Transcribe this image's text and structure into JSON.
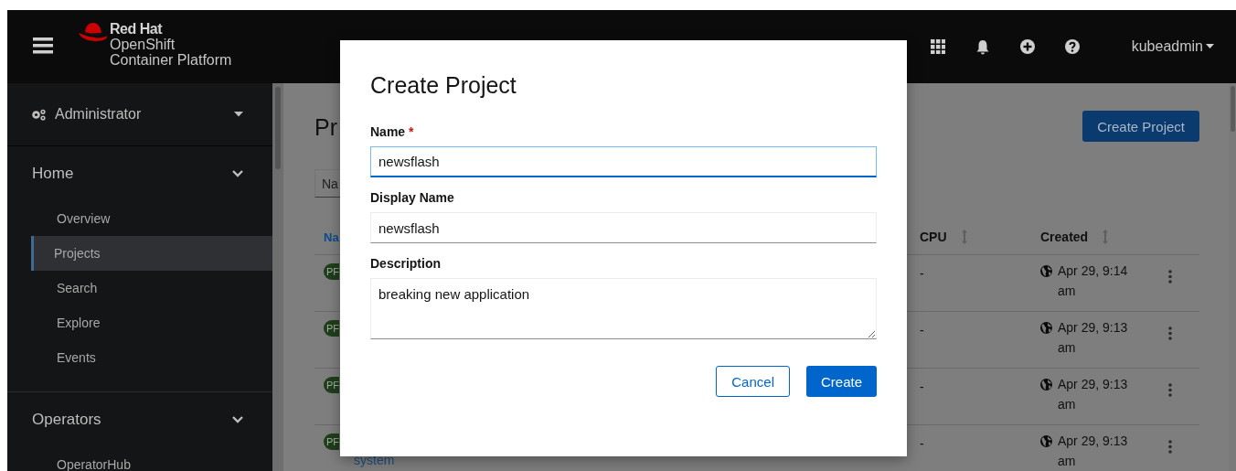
{
  "masthead": {
    "brand": [
      "Red Hat",
      "OpenShift",
      "Container Platform"
    ],
    "user": "kubeadmin"
  },
  "sidebar": {
    "perspective": "Administrator",
    "sections": [
      {
        "label": "Home",
        "expanded": true,
        "items": [
          {
            "label": "Overview",
            "selected": false
          },
          {
            "label": "Projects",
            "selected": true
          },
          {
            "label": "Search",
            "selected": false
          },
          {
            "label": "Explore",
            "selected": false
          },
          {
            "label": "Events",
            "selected": false
          }
        ]
      },
      {
        "label": "Operators",
        "expanded": true,
        "items": [
          {
            "label": "OperatorHub",
            "selected": false
          }
        ]
      }
    ]
  },
  "page": {
    "title": "Pr",
    "filter": "Na",
    "create_button": "Create Project",
    "columns": [
      {
        "label": "Na",
        "sorted": true
      },
      {
        "label": "CPU",
        "sorted": false
      },
      {
        "label": "Created",
        "sorted": false
      }
    ],
    "rows": [
      {
        "badge": "PF",
        "cpu": "-",
        "created": "Apr 29, 9:14 am"
      },
      {
        "badge": "PF",
        "cpu": "-",
        "created": "Apr 29, 9:13 am"
      },
      {
        "badge": "PF",
        "cpu": "-",
        "created": "Apr 29, 9:13 am"
      },
      {
        "badge": "PF",
        "link": "system",
        "cpu": "-",
        "created": "Apr 29, 9:13 am"
      }
    ]
  },
  "modal": {
    "title": "Create Project",
    "fields": [
      {
        "kind": "input",
        "label": "Name",
        "required_mark": "*",
        "value": "newsflash",
        "focused": true
      },
      {
        "kind": "input",
        "label": "Display Name",
        "value": "newsflash",
        "focused": false
      },
      {
        "kind": "textarea",
        "label": "Description",
        "value": "breaking new application",
        "focused": false
      }
    ],
    "buttons": [
      {
        "label": "Cancel",
        "kind": "secondary"
      },
      {
        "label": "Create",
        "kind": "primary"
      }
    ]
  }
}
